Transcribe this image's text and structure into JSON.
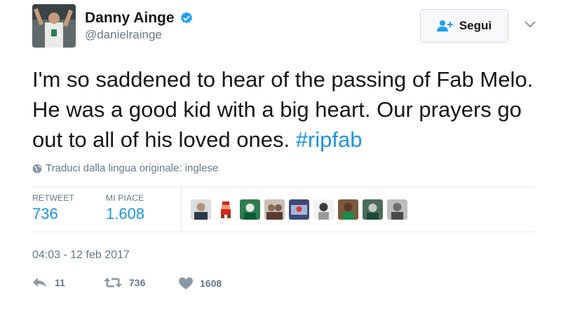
{
  "user": {
    "display_name": "Danny Ainge",
    "handle": "@danielrainge"
  },
  "follow_button": {
    "label": "Segui"
  },
  "tweet": {
    "text": "I'm so saddened to hear of the passing of Fab Melo. He was a good kid with a big heart. Our prayers go out to all of his loved ones. ",
    "hashtag": "#ripfab"
  },
  "translate": {
    "label": "Traduci dalla lingua originale: inglese"
  },
  "stats": {
    "retweets_label": "RETWEET",
    "retweets_value": "736",
    "likes_label": "MI PIACE",
    "likes_value": "1.608"
  },
  "timestamp": "04:03 - 12 feb 2017",
  "actions": {
    "reply_count": "11",
    "retweet_count": "736",
    "like_count": "1608"
  },
  "colors": {
    "link": "#1b95e0",
    "secondary_text": "#657786",
    "verified": "#1da1f2"
  },
  "icons": {
    "verified": "verified-badge-icon",
    "follow": "person-plus-icon",
    "caret": "chevron-down-icon",
    "globe": "globe-icon",
    "reply": "reply-icon",
    "retweet": "retweet-icon",
    "like": "heart-icon"
  }
}
